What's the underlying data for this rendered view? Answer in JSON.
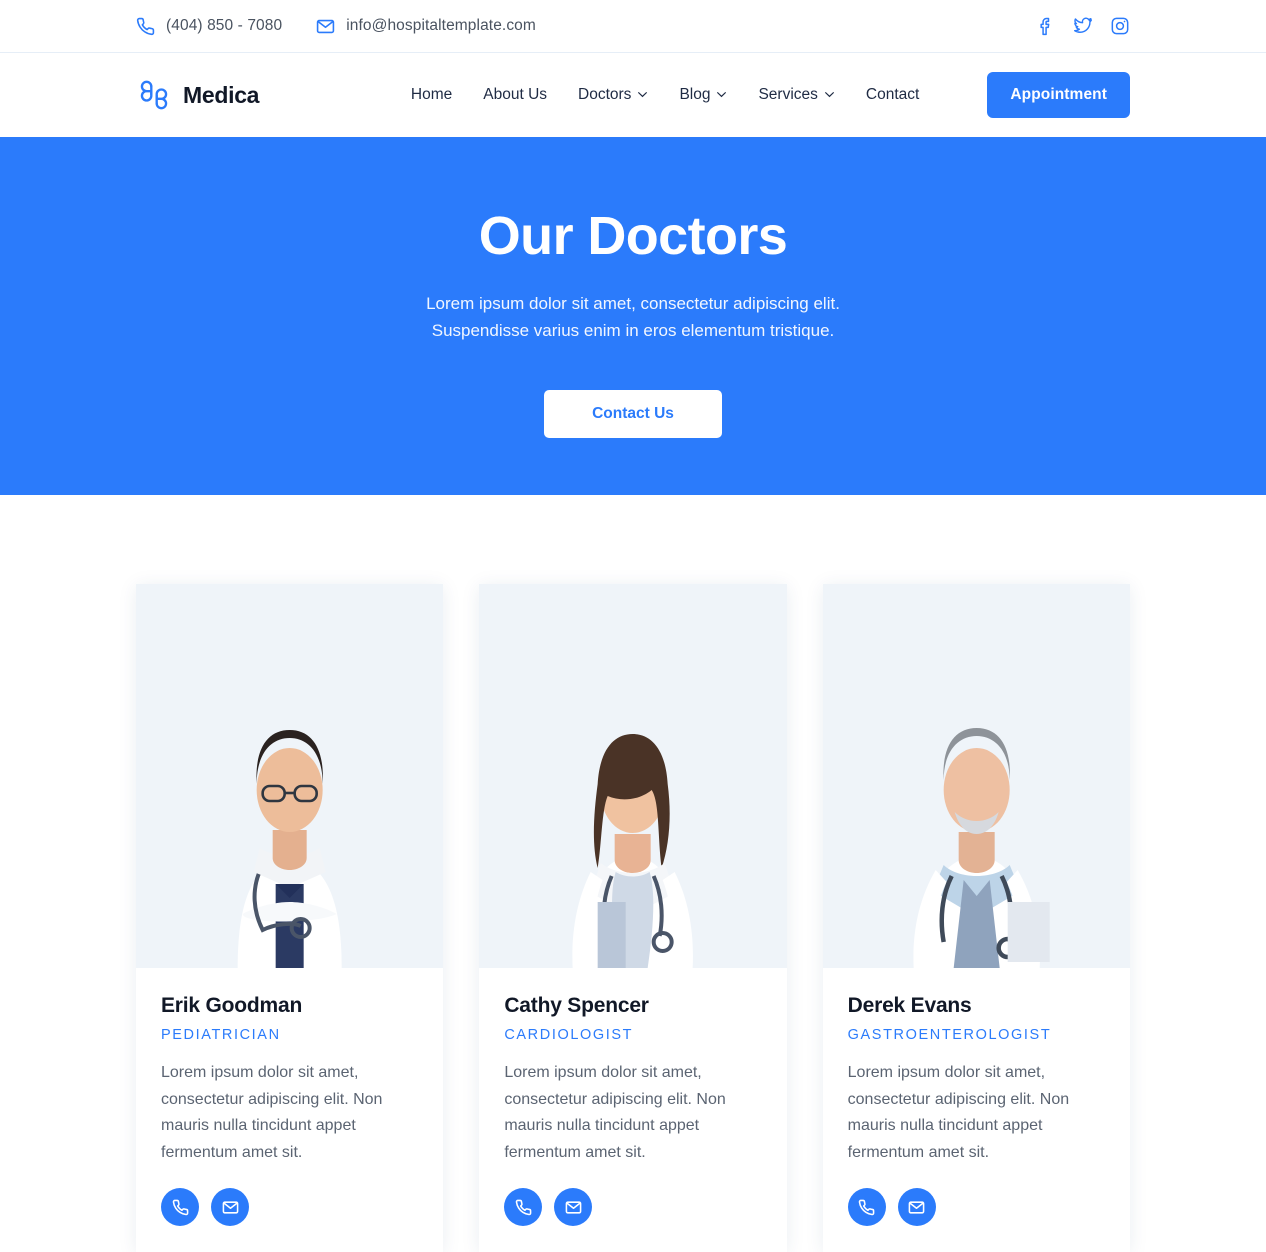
{
  "topbar": {
    "phone": "(404) 850 - 7080",
    "email": "info@hospitaltemplate.com",
    "phone_icon": "phone-icon",
    "email_icon": "envelope-icon",
    "socials": [
      {
        "name": "facebook-icon",
        "label": "Facebook"
      },
      {
        "name": "twitter-icon",
        "label": "Twitter"
      },
      {
        "name": "instagram-icon",
        "label": "Instagram"
      }
    ]
  },
  "header": {
    "brand_name": "Medica",
    "logo_icon": "medica-cross-logo-icon",
    "nav": [
      {
        "label": "Home",
        "has_dropdown": false
      },
      {
        "label": "About Us",
        "has_dropdown": false
      },
      {
        "label": "Doctors",
        "has_dropdown": true
      },
      {
        "label": "Blog",
        "has_dropdown": true
      },
      {
        "label": "Services",
        "has_dropdown": true
      },
      {
        "label": "Contact",
        "has_dropdown": false
      }
    ],
    "appointment_label": "Appointment"
  },
  "hero": {
    "title": "Our Doctors",
    "subtitle_line1": "Lorem ipsum dolor sit amet, consectetur adipiscing elit.",
    "subtitle_line2": "Suspendisse varius enim in eros elementum tristique.",
    "cta_label": "Contact Us"
  },
  "doctors": [
    {
      "name": "Erik Goodman",
      "role": "PEDIATRICIAN",
      "description": "Lorem ipsum dolor sit amet, consectetur adipiscing elit. Non mauris nulla tincidunt  appet fermentum amet sit.",
      "photo_alt": "Male doctor with glasses and stethoscope, arms crossed",
      "actions": [
        {
          "icon": "phone-icon",
          "label": "Call"
        },
        {
          "icon": "envelope-icon",
          "label": "Email"
        }
      ]
    },
    {
      "name": "Cathy Spencer",
      "role": "CARDIOLOGIST",
      "description": "Lorem ipsum dolor sit amet, consectetur adipiscing elit. Non mauris nulla tincidunt  appet fermentum amet sit.",
      "photo_alt": "Female doctor with long hair holding a clipboard",
      "actions": [
        {
          "icon": "phone-icon",
          "label": "Call"
        },
        {
          "icon": "envelope-icon",
          "label": "Email"
        }
      ]
    },
    {
      "name": "Derek Evans",
      "role": "GASTROENTEROLOGIST",
      "description": "Lorem ipsum dolor sit amet, consectetur adipiscing elit. Non mauris nulla tincidunt  appet fermentum amet sit.",
      "photo_alt": "Senior male doctor with grey beard and stethoscope holding a tablet",
      "actions": [
        {
          "icon": "phone-icon",
          "label": "Call"
        },
        {
          "icon": "envelope-icon",
          "label": "Email"
        }
      ]
    }
  ],
  "colors": {
    "accent": "#2b7bfb",
    "heading": "#111827",
    "body_text": "#5b6472",
    "photo_bg": "#eff4f9",
    "border": "#e6eef7"
  }
}
